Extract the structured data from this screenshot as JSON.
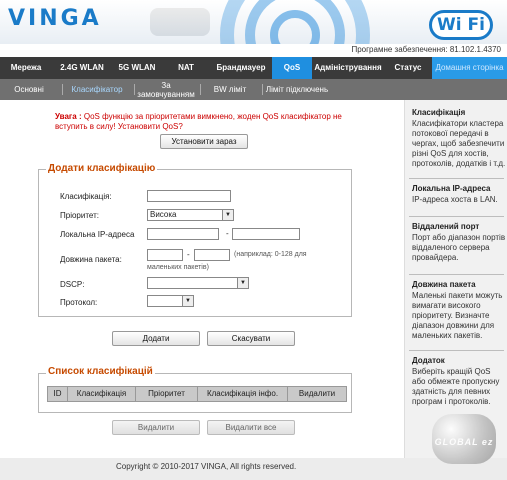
{
  "header": {
    "logo": "VINGA",
    "wifi_badge": "Wi Fi",
    "firmware": "Програмне забезпечення: 81.102.1.4370"
  },
  "nav": {
    "items": [
      "Мережа",
      "2.4G WLAN",
      "5G WLAN",
      "NAT",
      "Брандмауер",
      "QoS",
      "Адміністрування",
      "Статус",
      "Домашня сторінка"
    ]
  },
  "subnav": {
    "items": [
      "Основні",
      "Класифікатор",
      "За замовчуванням",
      "BW ліміт",
      "Ліміт підключень"
    ]
  },
  "warning": {
    "title": "Увага :",
    "text": "QoS функцію за пріоритетами вимкнено, жоден QoS класифікатор не вступить в силу! Установити QoS?"
  },
  "buttons": {
    "install_now": "Установити зараз",
    "add": "Додати",
    "cancel": "Скасувати",
    "delete": "Видалити",
    "delete_all": "Видалити все"
  },
  "add_form": {
    "legend": "Додати класифікацію",
    "classification_label": "Класифікація:",
    "priority_label": "Пріоритет:",
    "priority_value": "Висока",
    "local_ip_label": "Локальна IP-адреса",
    "ip_sep": "-",
    "packet_len_label": "Довжина пакета:",
    "len_sep": "-",
    "packet_hint_a": "(наприклад: 0-128 для",
    "packet_hint_b": "маленьких пакетів)",
    "dscp_label": "DSCP:",
    "protocol_label": "Протокол:"
  },
  "list": {
    "legend": "Список класифікацій",
    "columns": [
      "ID",
      "Класифікація",
      "Пріоритет",
      "Класифікація інфо.",
      "Видалити"
    ]
  },
  "sidebar": {
    "sections": [
      {
        "title": "Класифікація",
        "text": "Класифікатори кластера потокової передачі в чергах, щоб забезпечити різні QoS для хостів, протоколів, додатків і т.д."
      },
      {
        "title": "Локальна IP-адреса",
        "text": "IP-адреса хоста в LAN."
      },
      {
        "title": "Віддалений порт",
        "text": "Порт або діапазон портів віддаленого сервера провайдера."
      },
      {
        "title": "Довжина пакета",
        "text": "Маленькі пакети можуть вимагати високого пріоритету. Визначте діапазон довжини для маленьких пакетів."
      },
      {
        "title": "Додаток",
        "text": "Виберіть кращій QoS або обмежте пропускну здатність для певних програм і протоколів."
      }
    ]
  },
  "footer": {
    "copyright": "Copyright © 2010-2017 VINGA, All rights reserved."
  },
  "watermark": {
    "text": "GLOBAL ez"
  },
  "colors": {
    "accent": "#1f8fe0",
    "warning": "#cc0000",
    "legend": "#c64a00",
    "nav_bg": "#3a3a3a",
    "subnav_bg": "#707070"
  }
}
